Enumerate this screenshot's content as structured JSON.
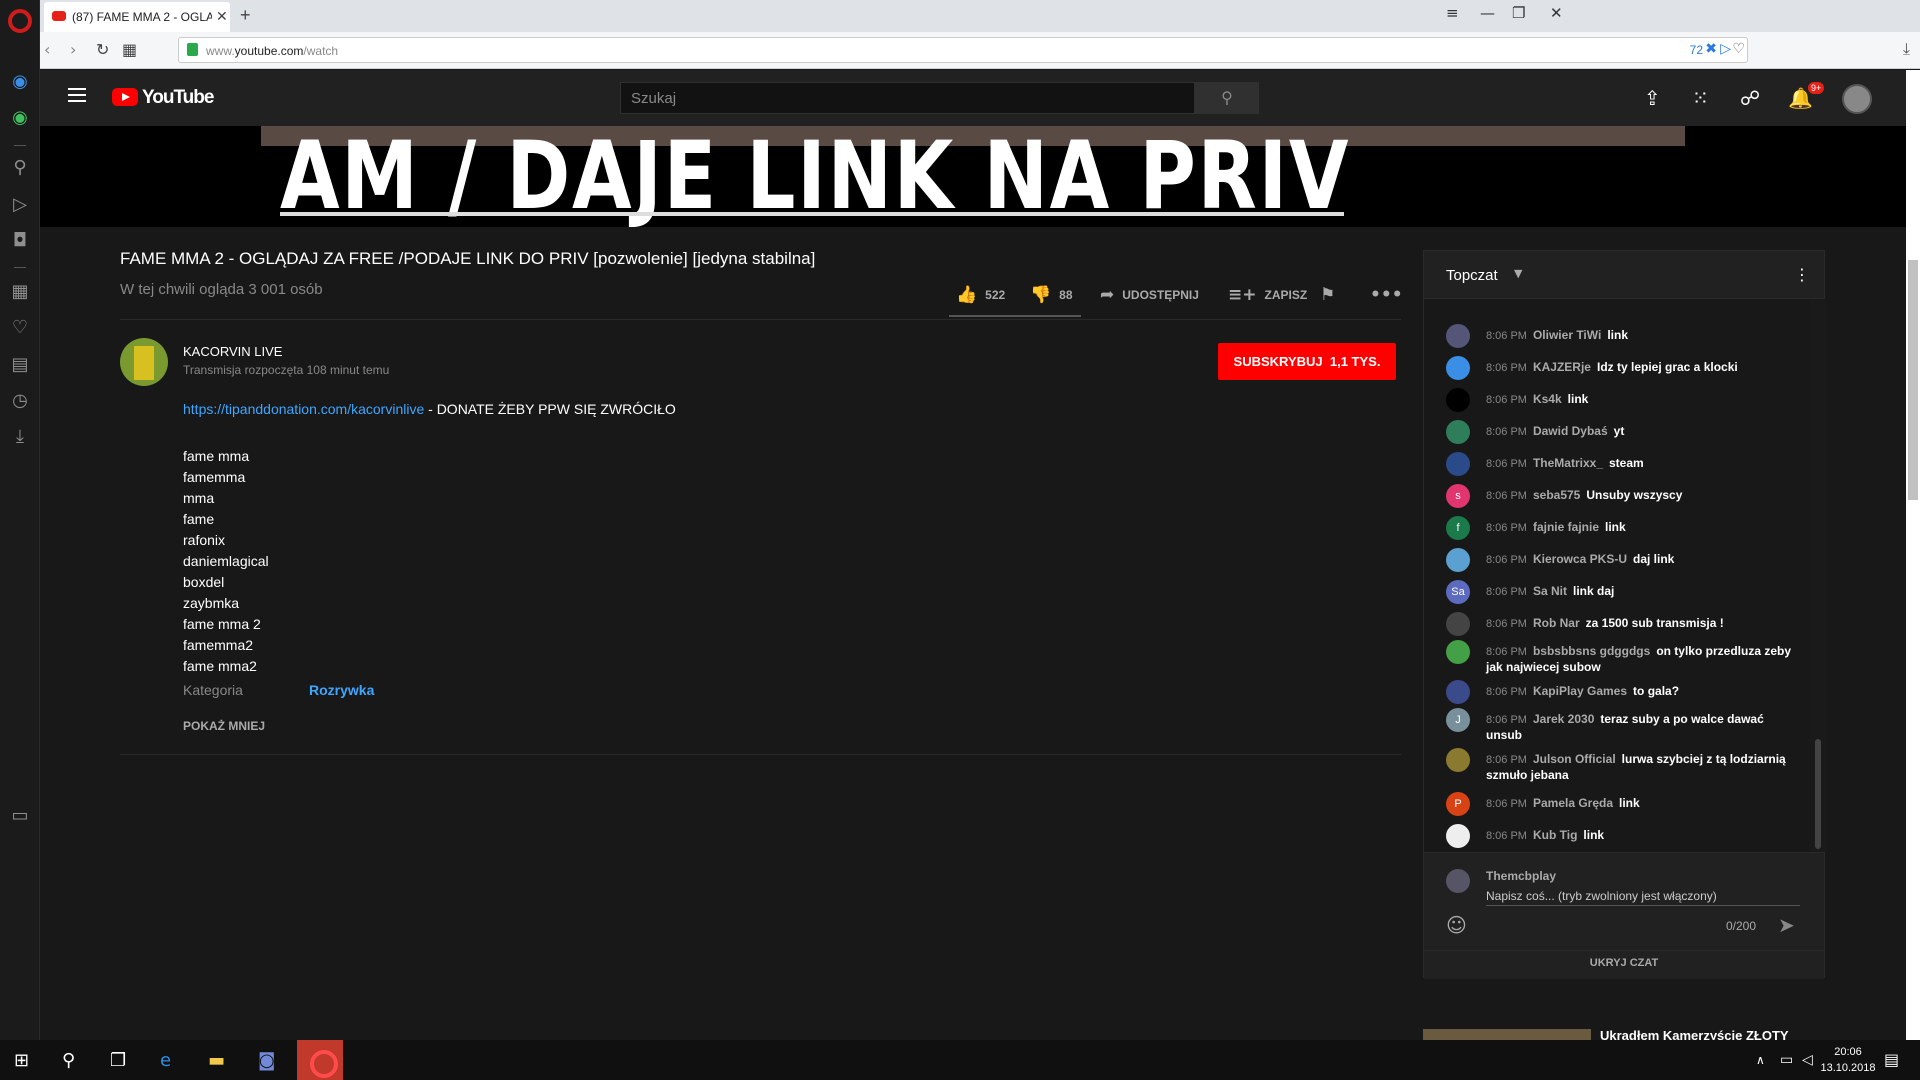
{
  "browser": {
    "tab_title": "(87) FAME MMA 2 - OGLĄ",
    "url_prefix": "www.",
    "url_host": "youtube.com",
    "url_path": "/watch",
    "adblock_count": "72"
  },
  "header": {
    "brand": "YouTube",
    "search_placeholder": "Szukaj",
    "notif_count": "9+"
  },
  "player": {
    "overlay_text": "AM / DAJE LINK NA PRIV"
  },
  "video": {
    "title": "FAME MMA 2 - OGLĄDAJ ZA FREE /PODAJE LINK DO PRIV [pozwolenie] [jedyna stabilna]",
    "viewers": "W tej chwili ogląda 3 001 osób",
    "likes": "522",
    "dislikes": "88",
    "share_label": "UDOSTĘPNIJ",
    "save_label": "ZAPISZ"
  },
  "channel": {
    "name": "KACORVIN LIVE",
    "started": "Transmisja rozpoczęta 108 minut temu",
    "subscribe_label": "SUBSKRYBUJ",
    "subscriber_count": "1,1 TYS."
  },
  "description": {
    "link": "https://tipanddonation.com/kacorvinlive",
    "link_suffix": " - DONATE ŻEBY PPW SIĘ ZWRÓCIŁO",
    "tags": [
      "fame mma",
      "famemma",
      "mma",
      "fame",
      "rafonix",
      "daniemlagical",
      "boxdel",
      "zaybmka",
      "fame mma 2",
      "famemma2",
      "fame mma2"
    ],
    "category_label": "Kategoria",
    "category_value": "Rozrywka",
    "show_less": "POKAŻ MNIEJ"
  },
  "chat": {
    "title": "Topczat",
    "messages": [
      {
        "time": "8:06 PM",
        "author": "Oliwier TiWi",
        "text": "link",
        "color": "#557"
      },
      {
        "time": "8:06 PM",
        "author": "KAJZERje",
        "text": "Idz ty lepiej grac a klocki",
        "color": "#3a8ee6"
      },
      {
        "time": "8:06 PM",
        "author": "Ks4k",
        "text": "link",
        "color": "#000000"
      },
      {
        "time": "8:06 PM",
        "author": "Dawid Dybaś",
        "text": "yt",
        "color": "#2e7d5b"
      },
      {
        "time": "8:06 PM",
        "author": "TheMatrixx_",
        "text": "steam",
        "color": "#2a4a8a"
      },
      {
        "time": "8:06 PM",
        "author": "seba575",
        "text": "Unsuby wszyscy",
        "color": "#e0356f",
        "initial": "s"
      },
      {
        "time": "8:06 PM",
        "author": "fajnie fajnie",
        "text": "link",
        "color": "#1b7a4a",
        "initial": "f"
      },
      {
        "time": "8:06 PM",
        "author": "Kierowca PKS-U",
        "text": "daj link",
        "color": "#5aa0d0"
      },
      {
        "time": "8:06 PM",
        "author": "Sa Nit",
        "text": "link daj",
        "color": "#5c6bc0",
        "initial": "Sa"
      },
      {
        "time": "8:06 PM",
        "author": "Rob Nar",
        "text": "za 1500 sub transmisja !",
        "color": "#444"
      },
      {
        "time": "8:06 PM",
        "author": "bsbsbbsns gdggdgs",
        "text": "on tylko przedluza zeby jak najwiecej subow",
        "color": "#43a047"
      },
      {
        "time": "8:06 PM",
        "author": "KapiPlay Games",
        "text": "to gala?",
        "color": "#3b4a8a"
      },
      {
        "time": "8:06 PM",
        "author": "Jarek 2030",
        "text": "teraz suby a po walce dawać unsub",
        "color": "#78909c",
        "initial": "J"
      },
      {
        "time": "8:06 PM",
        "author": "Julson Official",
        "text": "lurwa szybciej z tą lodziarnią szmuło jebana",
        "color": "#8a7a30"
      },
      {
        "time": "8:06 PM",
        "author": "Pamela Gręda",
        "text": "link",
        "color": "#d84315",
        "initial": "P"
      },
      {
        "time": "8:06 PM",
        "author": "Kub Tig",
        "text": "link",
        "color": "#eeeeee"
      }
    ],
    "input_user": "Themcbplay",
    "input_placeholder": "Napisz coś... (tryb zwolniony jest włączony)",
    "counter": "0/200",
    "hide_label": "UKRYJ CZAT"
  },
  "recommendation": {
    "title": "Ukradłem Kamerzyście ZŁOTY"
  },
  "taskbar": {
    "time": "20:06",
    "date": "13.10.2018"
  }
}
